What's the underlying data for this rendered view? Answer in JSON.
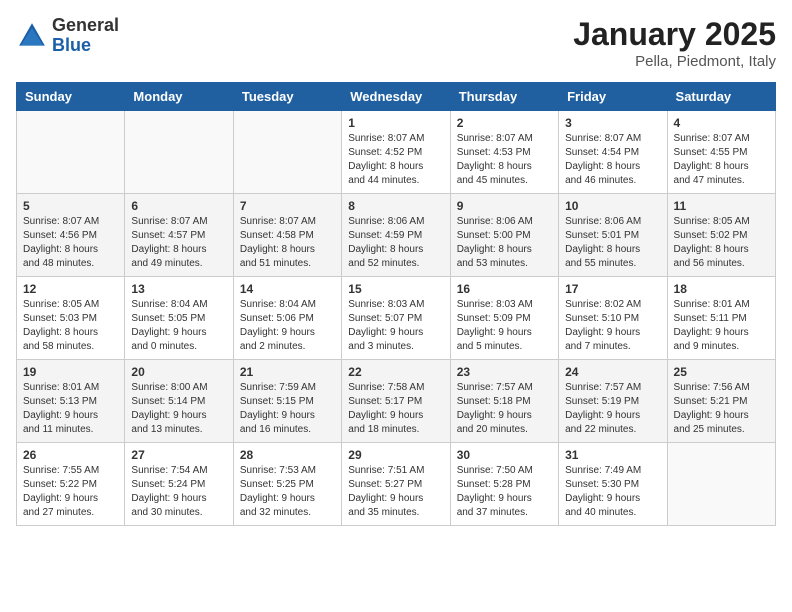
{
  "header": {
    "logo": {
      "general": "General",
      "blue": "Blue"
    },
    "title": "January 2025",
    "subtitle": "Pella, Piedmont, Italy"
  },
  "weekdays": [
    "Sunday",
    "Monday",
    "Tuesday",
    "Wednesday",
    "Thursday",
    "Friday",
    "Saturday"
  ],
  "weeks": [
    [
      {
        "day": "",
        "info": ""
      },
      {
        "day": "",
        "info": ""
      },
      {
        "day": "",
        "info": ""
      },
      {
        "day": "1",
        "info": "Sunrise: 8:07 AM\nSunset: 4:52 PM\nDaylight: 8 hours\nand 44 minutes."
      },
      {
        "day": "2",
        "info": "Sunrise: 8:07 AM\nSunset: 4:53 PM\nDaylight: 8 hours\nand 45 minutes."
      },
      {
        "day": "3",
        "info": "Sunrise: 8:07 AM\nSunset: 4:54 PM\nDaylight: 8 hours\nand 46 minutes."
      },
      {
        "day": "4",
        "info": "Sunrise: 8:07 AM\nSunset: 4:55 PM\nDaylight: 8 hours\nand 47 minutes."
      }
    ],
    [
      {
        "day": "5",
        "info": "Sunrise: 8:07 AM\nSunset: 4:56 PM\nDaylight: 8 hours\nand 48 minutes."
      },
      {
        "day": "6",
        "info": "Sunrise: 8:07 AM\nSunset: 4:57 PM\nDaylight: 8 hours\nand 49 minutes."
      },
      {
        "day": "7",
        "info": "Sunrise: 8:07 AM\nSunset: 4:58 PM\nDaylight: 8 hours\nand 51 minutes."
      },
      {
        "day": "8",
        "info": "Sunrise: 8:06 AM\nSunset: 4:59 PM\nDaylight: 8 hours\nand 52 minutes."
      },
      {
        "day": "9",
        "info": "Sunrise: 8:06 AM\nSunset: 5:00 PM\nDaylight: 8 hours\nand 53 minutes."
      },
      {
        "day": "10",
        "info": "Sunrise: 8:06 AM\nSunset: 5:01 PM\nDaylight: 8 hours\nand 55 minutes."
      },
      {
        "day": "11",
        "info": "Sunrise: 8:05 AM\nSunset: 5:02 PM\nDaylight: 8 hours\nand 56 minutes."
      }
    ],
    [
      {
        "day": "12",
        "info": "Sunrise: 8:05 AM\nSunset: 5:03 PM\nDaylight: 8 hours\nand 58 minutes."
      },
      {
        "day": "13",
        "info": "Sunrise: 8:04 AM\nSunset: 5:05 PM\nDaylight: 9 hours\nand 0 minutes."
      },
      {
        "day": "14",
        "info": "Sunrise: 8:04 AM\nSunset: 5:06 PM\nDaylight: 9 hours\nand 2 minutes."
      },
      {
        "day": "15",
        "info": "Sunrise: 8:03 AM\nSunset: 5:07 PM\nDaylight: 9 hours\nand 3 minutes."
      },
      {
        "day": "16",
        "info": "Sunrise: 8:03 AM\nSunset: 5:09 PM\nDaylight: 9 hours\nand 5 minutes."
      },
      {
        "day": "17",
        "info": "Sunrise: 8:02 AM\nSunset: 5:10 PM\nDaylight: 9 hours\nand 7 minutes."
      },
      {
        "day": "18",
        "info": "Sunrise: 8:01 AM\nSunset: 5:11 PM\nDaylight: 9 hours\nand 9 minutes."
      }
    ],
    [
      {
        "day": "19",
        "info": "Sunrise: 8:01 AM\nSunset: 5:13 PM\nDaylight: 9 hours\nand 11 minutes."
      },
      {
        "day": "20",
        "info": "Sunrise: 8:00 AM\nSunset: 5:14 PM\nDaylight: 9 hours\nand 13 minutes."
      },
      {
        "day": "21",
        "info": "Sunrise: 7:59 AM\nSunset: 5:15 PM\nDaylight: 9 hours\nand 16 minutes."
      },
      {
        "day": "22",
        "info": "Sunrise: 7:58 AM\nSunset: 5:17 PM\nDaylight: 9 hours\nand 18 minutes."
      },
      {
        "day": "23",
        "info": "Sunrise: 7:57 AM\nSunset: 5:18 PM\nDaylight: 9 hours\nand 20 minutes."
      },
      {
        "day": "24",
        "info": "Sunrise: 7:57 AM\nSunset: 5:19 PM\nDaylight: 9 hours\nand 22 minutes."
      },
      {
        "day": "25",
        "info": "Sunrise: 7:56 AM\nSunset: 5:21 PM\nDaylight: 9 hours\nand 25 minutes."
      }
    ],
    [
      {
        "day": "26",
        "info": "Sunrise: 7:55 AM\nSunset: 5:22 PM\nDaylight: 9 hours\nand 27 minutes."
      },
      {
        "day": "27",
        "info": "Sunrise: 7:54 AM\nSunset: 5:24 PM\nDaylight: 9 hours\nand 30 minutes."
      },
      {
        "day": "28",
        "info": "Sunrise: 7:53 AM\nSunset: 5:25 PM\nDaylight: 9 hours\nand 32 minutes."
      },
      {
        "day": "29",
        "info": "Sunrise: 7:51 AM\nSunset: 5:27 PM\nDaylight: 9 hours\nand 35 minutes."
      },
      {
        "day": "30",
        "info": "Sunrise: 7:50 AM\nSunset: 5:28 PM\nDaylight: 9 hours\nand 37 minutes."
      },
      {
        "day": "31",
        "info": "Sunrise: 7:49 AM\nSunset: 5:30 PM\nDaylight: 9 hours\nand 40 minutes."
      },
      {
        "day": "",
        "info": ""
      }
    ]
  ]
}
